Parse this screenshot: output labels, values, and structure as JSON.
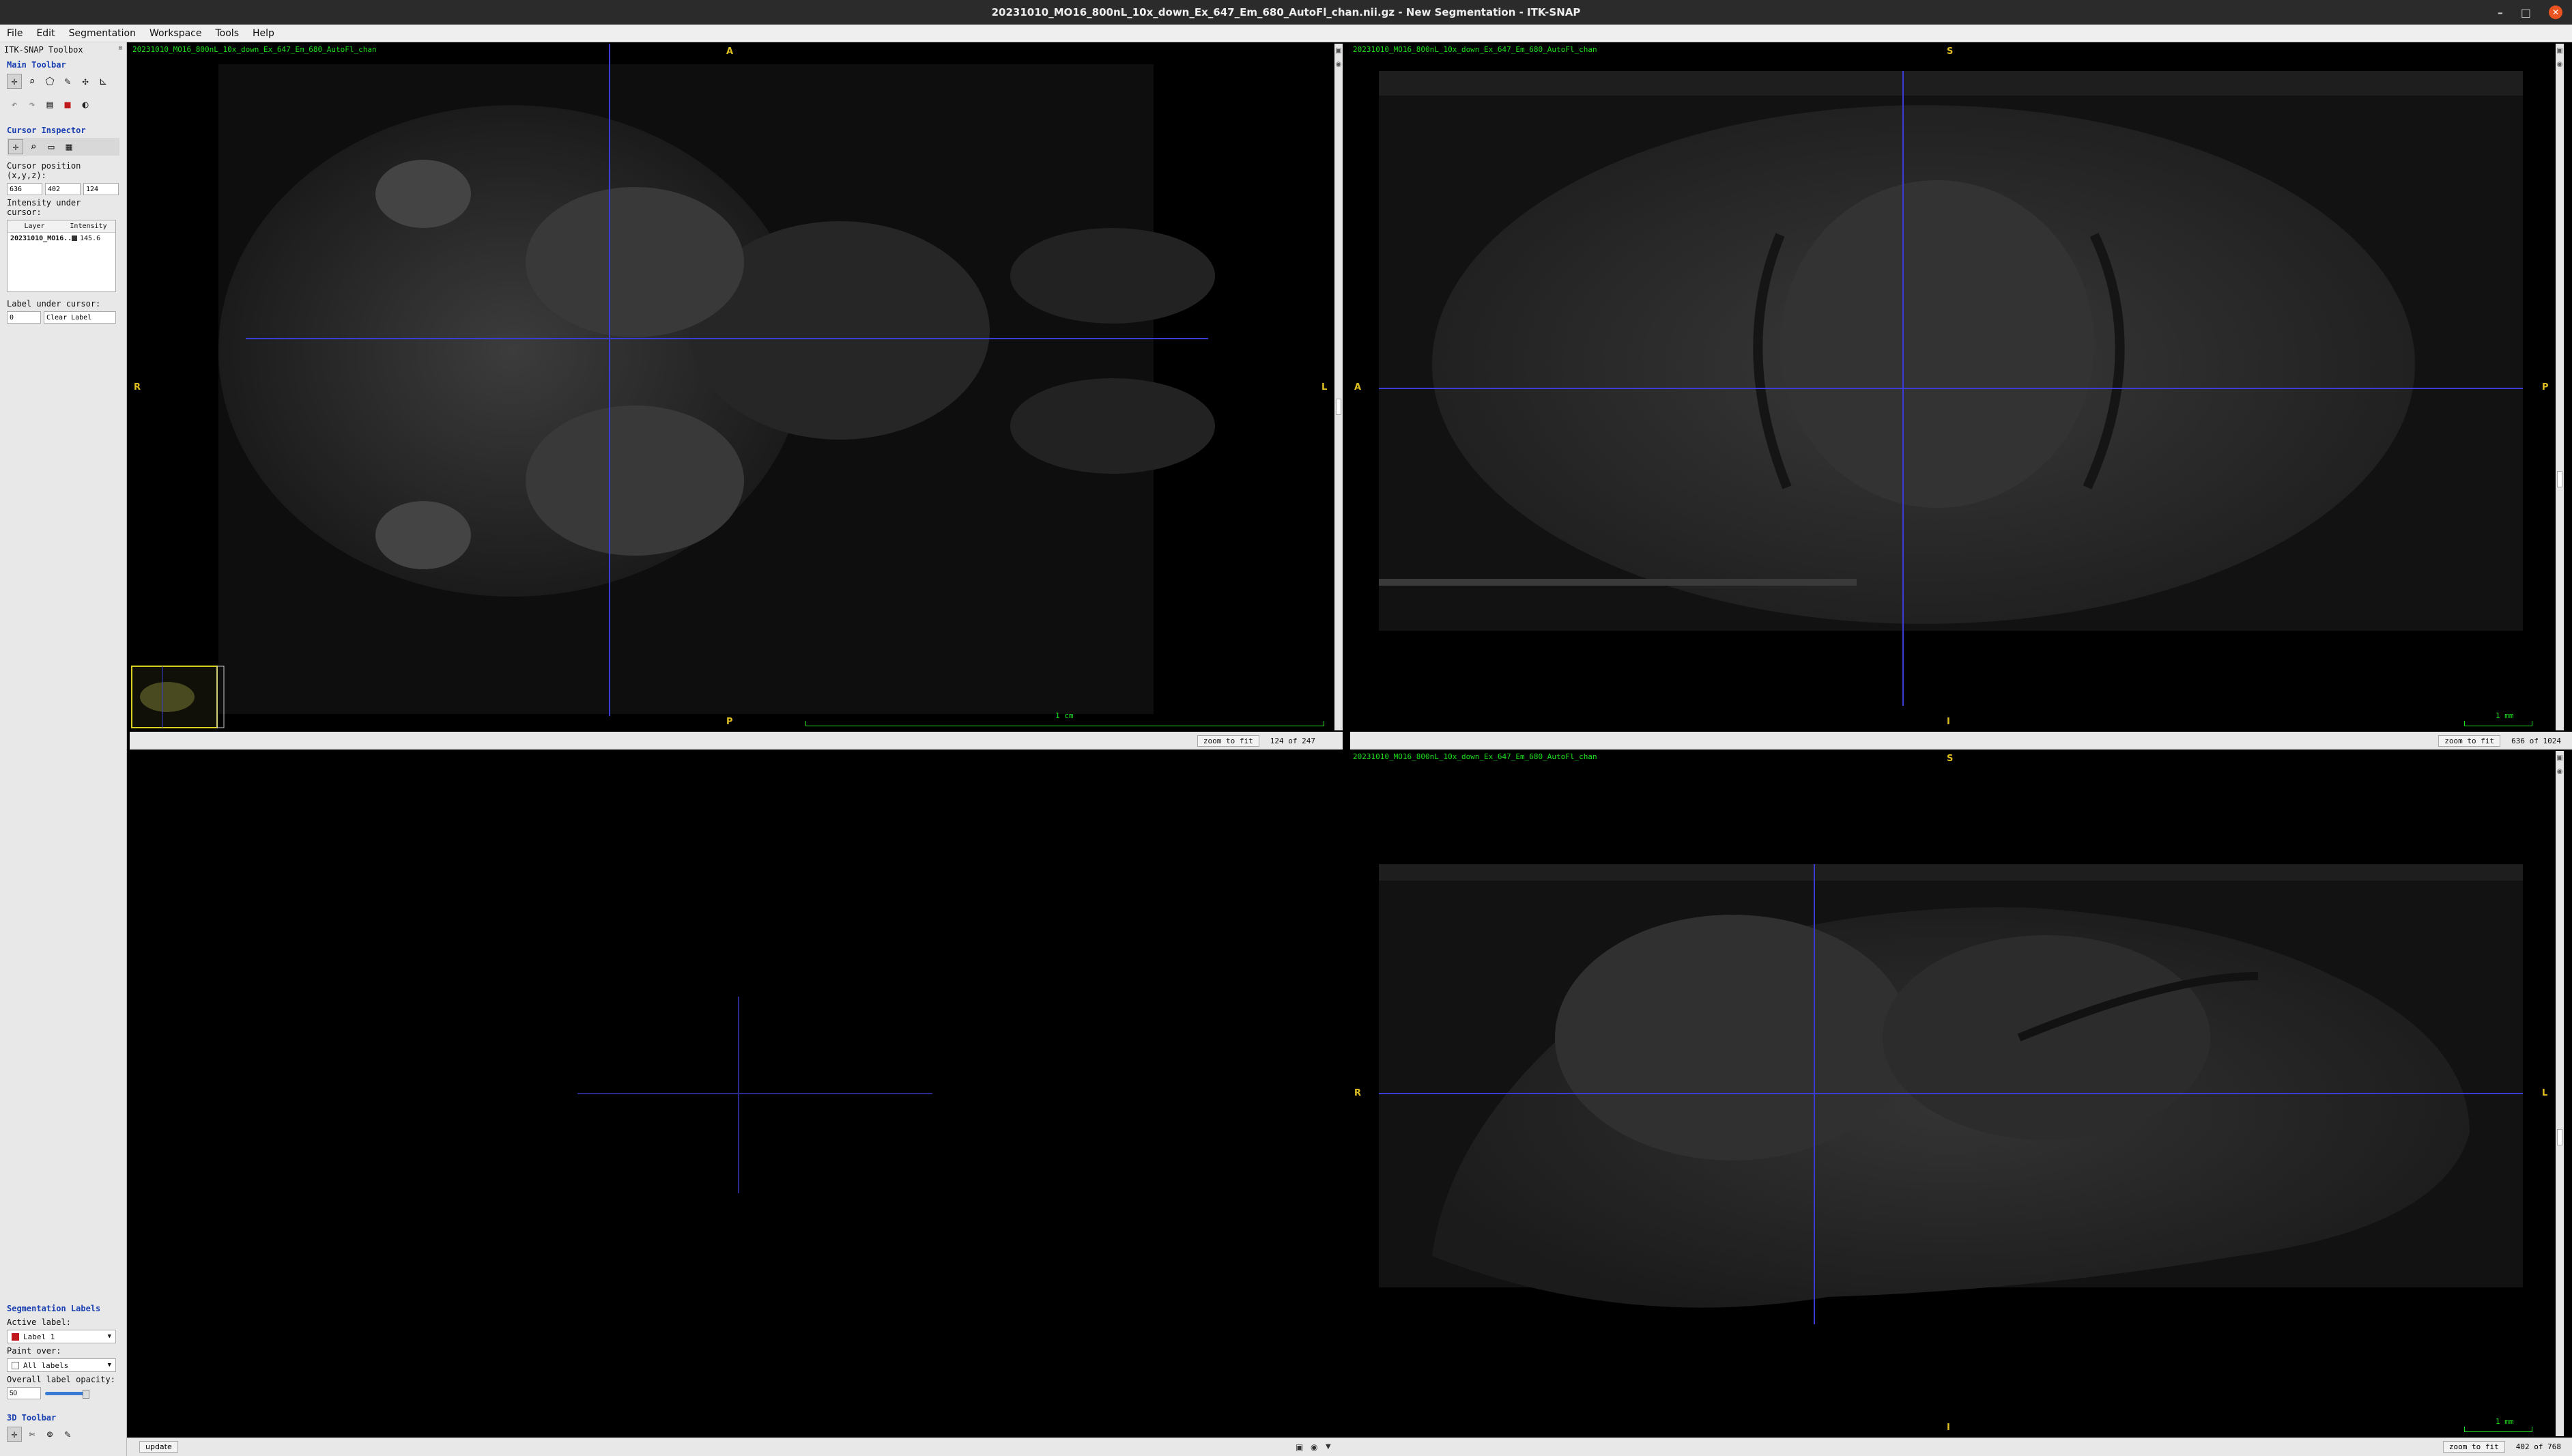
{
  "window": {
    "title": "20231010_MO16_800nL_10x_down_Ex_647_Em_680_AutoFl_chan.nii.gz - New Segmentation - ITK-SNAP"
  },
  "menu": [
    "File",
    "Edit",
    "Segmentation",
    "Workspace",
    "Tools",
    "Help"
  ],
  "toolbox": {
    "title": "ITK-SNAP Toolbox",
    "main_toolbar_title": "Main Toolbar",
    "main_tools": [
      "crosshair-icon",
      "zoom-icon",
      "polygon-icon",
      "paintbrush-icon",
      "snake-icon",
      "ruler-icon"
    ],
    "undo_tools": [
      "undo-icon",
      "redo-icon",
      "layer-icon",
      "segment-icon",
      "workspace-icon"
    ]
  },
  "cursor_inspector": {
    "title": "Cursor Inspector",
    "position_label": "Cursor position (x,y,z):",
    "x": "636",
    "y": "402",
    "z": "124",
    "intensity_label": "Intensity under cursor:",
    "columns": [
      "Layer",
      "Intensity"
    ],
    "rows": [
      {
        "layer": "20231010_MO16...",
        "intensity": "145.6"
      }
    ],
    "label_under_cursor": "Label under cursor:",
    "label_id": "0",
    "label_name": "Clear Label"
  },
  "segmentation_labels": {
    "title": "Segmentation Labels",
    "active_label_caption": "Active label:",
    "active_label": "Label 1",
    "active_color": "#c0181c",
    "paint_over_caption": "Paint over:",
    "paint_over": "All labels",
    "opacity_caption": "Overall label opacity:",
    "opacity": "50"
  },
  "toolbar3d": {
    "title": "3D Toolbar"
  },
  "views": {
    "axial": {
      "title": "20231010_MO16_800nL_10x_down_Ex_647_Em_680_AutoFl_chan",
      "top": "A",
      "bottom": "P",
      "left": "R",
      "right": "L",
      "scale": "1 cm",
      "zoom_btn": "zoom to fit",
      "slice": "124 of 247"
    },
    "coronal": {
      "title": "20231010_MO16_800nL_10x_down_Ex_647_Em_680_AutoFl_chan",
      "top": "S",
      "bottom": "I",
      "left": "A",
      "right": "P",
      "scale": "1 mm",
      "zoom_btn": "zoom to fit",
      "slice": "636 of 1024"
    },
    "sagittal": {
      "title": "20231010_MO16_800nL_10x_down_Ex_647_Em_680_AutoFl_chan",
      "top": "S",
      "bottom": "I",
      "left": "R",
      "right": "L",
      "scale": "1 mm",
      "zoom_btn": "zoom to fit",
      "slice": "402 of 768"
    },
    "three_d": {
      "update_btn": "update"
    }
  },
  "colors": {
    "crosshair": "#3b3bd6",
    "overlay_text": "#1ee01e",
    "orientation": "#e0c020",
    "toolbox_heading": "#1a3fb0"
  }
}
